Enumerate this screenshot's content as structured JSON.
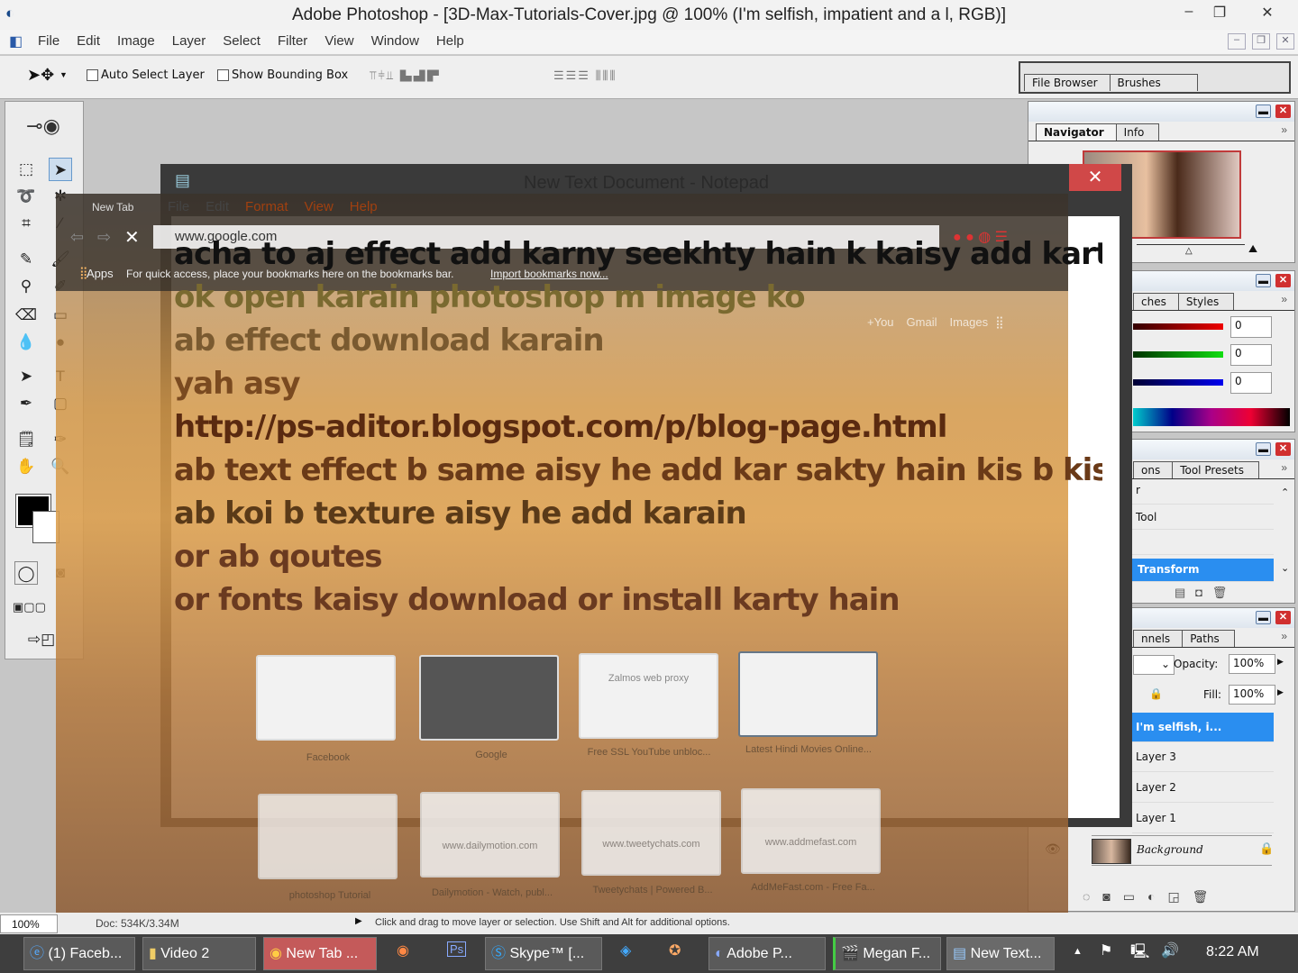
{
  "app": {
    "title": "Adobe Photoshop - [3D-Max-Tutorials-Cover.jpg @ 100% (I'm selfish, impatient and a l, RGB)]"
  },
  "menu": [
    "File",
    "Edit",
    "Image",
    "Layer",
    "Select",
    "Filter",
    "View",
    "Window",
    "Help"
  ],
  "options": {
    "auto_select": "Auto Select Layer",
    "bounding_box": "Show Bounding Box"
  },
  "palette_well": {
    "tabs": [
      "File Browser",
      "Brushes"
    ]
  },
  "navigator": {
    "tabs": [
      "Navigator",
      "Info"
    ]
  },
  "color_panel": {
    "tabs": [
      "ches",
      "Styles"
    ],
    "r": "0",
    "g": "0",
    "b": "0"
  },
  "history": {
    "tabs": [
      "ons",
      "Tool Presets"
    ],
    "items": [
      "r",
      "Tool",
      "",
      "Transform"
    ]
  },
  "layers": {
    "tabs": [
      "nnels",
      "Paths"
    ],
    "opacity_label": "Opacity:",
    "opacity": "100%",
    "fill_label": "Fill:",
    "fill": "100%",
    "items": [
      "I'm selfish, i...",
      "Layer 3",
      "Layer 2",
      "Layer 1",
      "Background"
    ]
  },
  "notepad": {
    "title": "New Text Document - Notepad",
    "menu": [
      "File",
      "Edit",
      "Format",
      "View",
      "Help"
    ],
    "lines": [
      "acha to aj effect add karny seekhty hain k kaisy add karty h",
      "ok open karain photoshop m image ko",
      "ab effect download karain",
      "yah asy",
      "http://ps-aditor.blogspot.com/p/blog-page.html",
      "ab text effect b same aisy he add kar sakty hain kis b kism k",
      "ab koi b texture aisy he add karain",
      "or ab qoutes",
      "or fonts kaisy download or install karty hain"
    ]
  },
  "chrome": {
    "tab": "New Tab",
    "url": "www.google.com",
    "apps": "Apps",
    "bookmarks_hint": "For quick access, place your bookmarks here on the bookmarks bar.",
    "import_link": "Import bookmarks now...",
    "links": [
      "+You",
      "Gmail",
      "Images"
    ],
    "tiles": [
      {
        "label": "Facebook",
        "preview": ""
      },
      {
        "label": "Google",
        "preview": ""
      },
      {
        "label": "Free SSL YouTube unbloc...",
        "preview": "Zalmos web proxy"
      },
      {
        "label": "Latest Hindi Movies Online...",
        "preview": ""
      },
      {
        "label": "photoshop Tutorial",
        "preview": ""
      },
      {
        "label": "Dailymotion - Watch, publ...",
        "preview": "www.dailymotion.com"
      },
      {
        "label": "Tweetychats | Powered B...",
        "preview": "www.tweetychats.com"
      },
      {
        "label": "AddMeFast.com - Free Fa...",
        "preview": "www.addmefast.com"
      }
    ]
  },
  "status": {
    "zoom": "100%",
    "doc": "Doc: 534K/3.34M",
    "hint": "Click and drag to move layer or selection.  Use Shift and Alt for additional options."
  },
  "taskbar": {
    "items": [
      "(1) Faceb...",
      "Video 2",
      "New Tab ...",
      "Skype™ [...",
      "Adobe P...",
      "Megan F...",
      "New Text..."
    ],
    "time": "8:22 AM"
  }
}
